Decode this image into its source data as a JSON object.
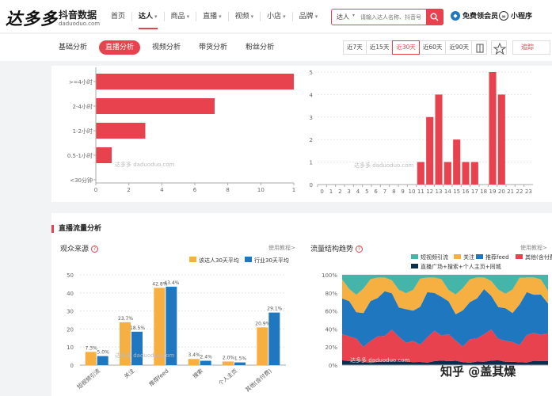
{
  "brand": {
    "logo_text": "达多多",
    "subtitle": "抖音数据",
    "url": "daduoduo.com"
  },
  "nav": {
    "items": [
      {
        "label": "首页",
        "caret": false,
        "active": false
      },
      {
        "label": "达人",
        "caret": true,
        "active": true
      },
      {
        "label": "商品",
        "caret": true,
        "active": false
      },
      {
        "label": "直播",
        "caret": true,
        "active": false
      },
      {
        "label": "视频",
        "caret": true,
        "active": false
      },
      {
        "label": "小店",
        "caret": true,
        "active": false
      },
      {
        "label": "品牌",
        "caret": true,
        "active": false
      }
    ]
  },
  "search": {
    "type": "达人",
    "placeholder": "请输入达人名称、抖音号"
  },
  "header": {
    "vip_label": "免费领会员",
    "mini_label": "小程序"
  },
  "subnav": {
    "tabs": [
      "基础分析",
      "直播分析",
      "视频分析",
      "带货分析",
      "粉丝分析"
    ],
    "active_tab": 1,
    "ranges": [
      "近7天",
      "近15天",
      "近30天",
      "近60天",
      "近90天"
    ],
    "active_range": 2,
    "track_label": "追踪"
  },
  "section2": {
    "title": "直播流量分析",
    "left_title": "观众来源",
    "right_title": "流量结构趋势",
    "usage_label": "使用教程>"
  },
  "icons": {
    "search": "search-icon",
    "vip": "diamond-icon",
    "mini": "mini-program-icon",
    "compare": "compare-icon",
    "star": "star-icon",
    "help": "help-icon"
  },
  "colors": {
    "accent": "#e8424e",
    "orange": "#f5b041",
    "blue": "#1f77c0",
    "teal": "#45b5aa",
    "navy": "#0b2e4f"
  },
  "watermark_text": "知乎 @盖其燥",
  "chart_data": [
    {
      "type": "bar",
      "orientation": "horizontal",
      "categories": [
        ">=4小时",
        "2-4小时",
        "1-2小时",
        "0.5-1小时",
        "<30分钟"
      ],
      "values": [
        1,
        0.6,
        0.25,
        0.08,
        0
      ],
      "xlim": [
        0,
        1
      ],
      "xticks": [
        "0",
        "2",
        "4",
        "6",
        "8",
        "10",
        "1"
      ]
    },
    {
      "type": "bar",
      "categories": [
        "0",
        "1",
        "2",
        "3",
        "4",
        "5",
        "6",
        "7",
        "8",
        "9",
        "10",
        "11",
        "12",
        "13",
        "14",
        "15",
        "16",
        "17",
        "18",
        "19",
        "20",
        "21",
        "22",
        "23"
      ],
      "values": [
        0,
        0,
        0,
        0,
        0,
        0,
        0,
        0,
        0,
        0,
        0,
        1,
        3,
        4,
        1,
        2,
        1,
        1,
        0,
        5,
        4,
        0,
        0,
        0
      ],
      "ylim": [
        0,
        5
      ],
      "yticks": [
        "0",
        "1",
        "2",
        "3",
        "4",
        "5"
      ]
    },
    {
      "type": "bar",
      "categories": [
        "短视频引流",
        "关注",
        "推荐feed",
        "搜索",
        "个人主页",
        "其他(含付费)"
      ],
      "series": [
        {
          "name": "该达人30天平均",
          "values": [
            7.3,
            23.7,
            42.8,
            3.4,
            2.0,
            20.9
          ],
          "color": "#f5b041"
        },
        {
          "name": "行业30天平均",
          "values": [
            5.0,
            18.5,
            43.4,
            2.4,
            1.5,
            29.1
          ],
          "color": "#1f77c0"
        }
      ],
      "ylim": [
        0,
        50
      ],
      "yticks": [
        "0",
        "10",
        "20",
        "30",
        "40",
        "50"
      ]
    },
    {
      "type": "area",
      "stacked": true,
      "normalized": true,
      "series": [
        {
          "name": "短视频引流",
          "color": "#45b5aa"
        },
        {
          "name": "关注",
          "color": "#f5b041"
        },
        {
          "name": "推荐feed",
          "color": "#1f77c0"
        },
        {
          "name": "其他(含付费)",
          "color": "#e8424e"
        },
        {
          "name": "直播广场+搜索+个人主页+同城",
          "color": "#0b2e4f"
        }
      ],
      "yticks": [
        "0%",
        "20%",
        "40%",
        "60%",
        "80%",
        "100%"
      ],
      "points": 30
    }
  ]
}
